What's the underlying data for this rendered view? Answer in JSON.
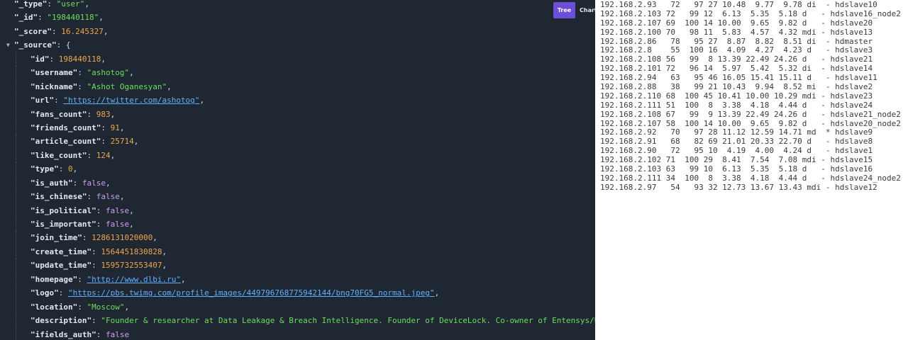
{
  "json_viewer": {
    "view_toggle": {
      "tree_label": "Tree",
      "chart_label": "Chart"
    },
    "lines": [
      {
        "indent": 0,
        "key": "\"_type\"",
        "type": "str",
        "value": "\"user\"",
        "comma": true
      },
      {
        "indent": 0,
        "key": "\"_id\"",
        "type": "str",
        "value": "\"198440118\"",
        "comma": true
      },
      {
        "indent": 0,
        "key": "\"_score\"",
        "type": "num",
        "value": "16.245327",
        "comma": true
      },
      {
        "indent": 0,
        "key": "\"_source\"",
        "type": "open",
        "value": "{",
        "comma": false,
        "toggle": "▼"
      },
      {
        "indent": 1,
        "key": "\"id\"",
        "type": "num",
        "value": "198440118",
        "comma": true
      },
      {
        "indent": 1,
        "key": "\"username\"",
        "type": "str",
        "value": "\"ashotog\"",
        "comma": true
      },
      {
        "indent": 1,
        "key": "\"nickname\"",
        "type": "str",
        "value": "\"Ashot Oganesyan\"",
        "comma": true
      },
      {
        "indent": 1,
        "key": "\"url\"",
        "type": "link",
        "value": "\"https://twitter.com/ashotog\"",
        "comma": true
      },
      {
        "indent": 1,
        "key": "\"fans_count\"",
        "type": "num",
        "value": "983",
        "comma": true
      },
      {
        "indent": 1,
        "key": "\"friends_count\"",
        "type": "num",
        "value": "91",
        "comma": true
      },
      {
        "indent": 1,
        "key": "\"article_count\"",
        "type": "num",
        "value": "25714",
        "comma": true
      },
      {
        "indent": 1,
        "key": "\"like_count\"",
        "type": "num",
        "value": "124",
        "comma": true
      },
      {
        "indent": 1,
        "key": "\"type\"",
        "type": "num",
        "value": "0",
        "comma": true
      },
      {
        "indent": 1,
        "key": "\"is_auth\"",
        "type": "bool",
        "value": "false",
        "comma": true
      },
      {
        "indent": 1,
        "key": "\"is_chinese\"",
        "type": "bool",
        "value": "false",
        "comma": true
      },
      {
        "indent": 1,
        "key": "\"is_political\"",
        "type": "bool",
        "value": "false",
        "comma": true
      },
      {
        "indent": 1,
        "key": "\"is_important\"",
        "type": "bool",
        "value": "false",
        "comma": true
      },
      {
        "indent": 1,
        "key": "\"join_time\"",
        "type": "num",
        "value": "1286131020000",
        "comma": true
      },
      {
        "indent": 1,
        "key": "\"create_time\"",
        "type": "num",
        "value": "1564451830828",
        "comma": true
      },
      {
        "indent": 1,
        "key": "\"update_time\"",
        "type": "num",
        "value": "1595732553407",
        "comma": true
      },
      {
        "indent": 1,
        "key": "\"homepage\"",
        "type": "link",
        "value": "\"http://www.dlbi.ru\"",
        "comma": true
      },
      {
        "indent": 1,
        "key": "\"logo\"",
        "type": "link",
        "value": "\"https://pbs.twimg.com/profile_images/449796768775942144/bng70FG5_normal.jpeg\"",
        "comma": true
      },
      {
        "indent": 1,
        "key": "\"location\"",
        "type": "str",
        "value": "\"Moscow\"",
        "comma": true
      },
      {
        "indent": 1,
        "key": "\"description\"",
        "type": "str",
        "value": "\"Founder & researcher at Data Leakage & Breach Intelligence. Founder of DeviceLock. Co-owner of Entensys/UserGate.\"",
        "comma": true
      },
      {
        "indent": 1,
        "key": "\"ifields_auth\"",
        "type": "bool",
        "value": "false",
        "comma": false
      }
    ]
  },
  "host_table": {
    "rows": [
      "192.168.2.93   72   97 27 10.48  9.77  9.78 di  - hdslave10",
      "192.168.2.103 72   99 12  6.13  5.35  5.18 d   - hdslave16_node2",
      "192.168.2.107 69  100 14 10.00  9.65  9.82 d   - hdslave20",
      "192.168.2.100 70   98 11  5.83  4.57  4.32 mdi - hdslave13",
      "192.168.2.86   78   95 27  8.87  8.82  8.51 di  - hdmaster",
      "192.168.2.8    55  100 16  4.09  4.27  4.23 d   - hdslave3",
      "192.168.2.108 56   99  8 13.39 22.49 24.26 d   - hdslave21",
      "192.168.2.101 72   96 14  5.97  5.42  5.32 di  - hdslave14",
      "192.168.2.94   63   95 46 16.05 15.41 15.11 d   - hdslave11",
      "192.168.2.88   38   99 21 10.43  9.94  8.52 mi  - hdslave2",
      "192.168.2.110 68  100 45 10.41 10.00 10.29 mdi - hdslave23",
      "192.168.2.111 51  100  8  3.38  4.18  4.44 d   - hdslave24",
      "192.168.2.108 67   99  9 13.39 22.49 24.26 d   - hdslave21_node2",
      "192.168.2.107 58  100 14 10.00  9.65  9.82 d   - hdslave20_node2",
      "192.168.2.92   70   97 28 11.12 12.59 14.71 md  * hdslave9",
      "192.168.2.91   68   82 69 21.01 20.33 22.70 d   - hdslave8",
      "192.168.2.90   72   95 10  4.19  4.00  4.24 d   - hdslave1",
      "192.168.2.102 71  100 29  8.41  7.54  7.08 mdi - hdslave15",
      "192.168.2.103 63   99 10  6.13  5.35  5.18 d   - hdslave16",
      "192.168.2.111 34  100  8  3.38  4.18  4.44 d   - hdslave24_node2",
      "192.168.2.97   54   93 32 12.73 13.67 13.43 mdi - hdslave12"
    ]
  }
}
